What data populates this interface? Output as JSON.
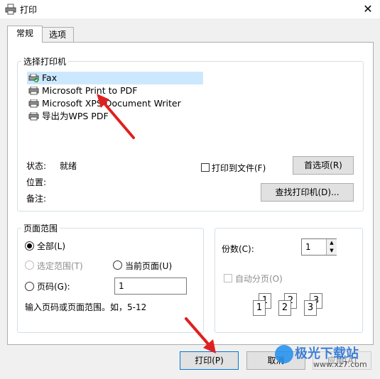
{
  "window": {
    "title": "打印",
    "close_glyph": "✕"
  },
  "tabs": [
    {
      "label": "常规",
      "active": true
    },
    {
      "label": "选项",
      "active": false
    }
  ],
  "printer_group": {
    "title": "选择打印机",
    "printers": [
      {
        "label": "Fax",
        "selected": true,
        "default": true
      },
      {
        "label": "Microsoft Print to PDF",
        "selected": false
      },
      {
        "label": "Microsoft XPS Document Writer",
        "selected": false
      },
      {
        "label": "导出为WPS PDF",
        "selected": false
      }
    ],
    "status_label": "状态:",
    "status_value": "就绪",
    "location_label": "位置:",
    "comment_label": "备注:",
    "print_to_file_label": "打印到文件(F)",
    "print_to_file_checked": false,
    "preferences_label": "首选项(R)",
    "find_printer_label": "查找打印机(D)..."
  },
  "page_range": {
    "title": "页面范围",
    "all_label": "全部(L)",
    "selection_label": "选定范围(T)",
    "current_label": "当前页面(U)",
    "pages_label": "页码(G):",
    "pages_value": "1",
    "hint": "输入页码或页面范围。如，5-12",
    "selected": "all"
  },
  "copies": {
    "label": "份数(C):",
    "value": "1",
    "collate_label": "自动分页(O)",
    "collate_checked": false,
    "collate_enabled": false,
    "collate_pages": [
      "1",
      "1",
      "2",
      "2",
      "3",
      "3"
    ]
  },
  "footer": {
    "print_label": "打印(P)",
    "cancel_label": "取消",
    "apply_label": "应用(A)"
  },
  "watermark": {
    "brand": "极光下载站",
    "url": "www.xz7.com"
  },
  "colors": {
    "accent": "#0078d7",
    "selection": "#cce8ff",
    "annotation_arrow": "#e02020",
    "check_green": "#1e9e3a"
  }
}
